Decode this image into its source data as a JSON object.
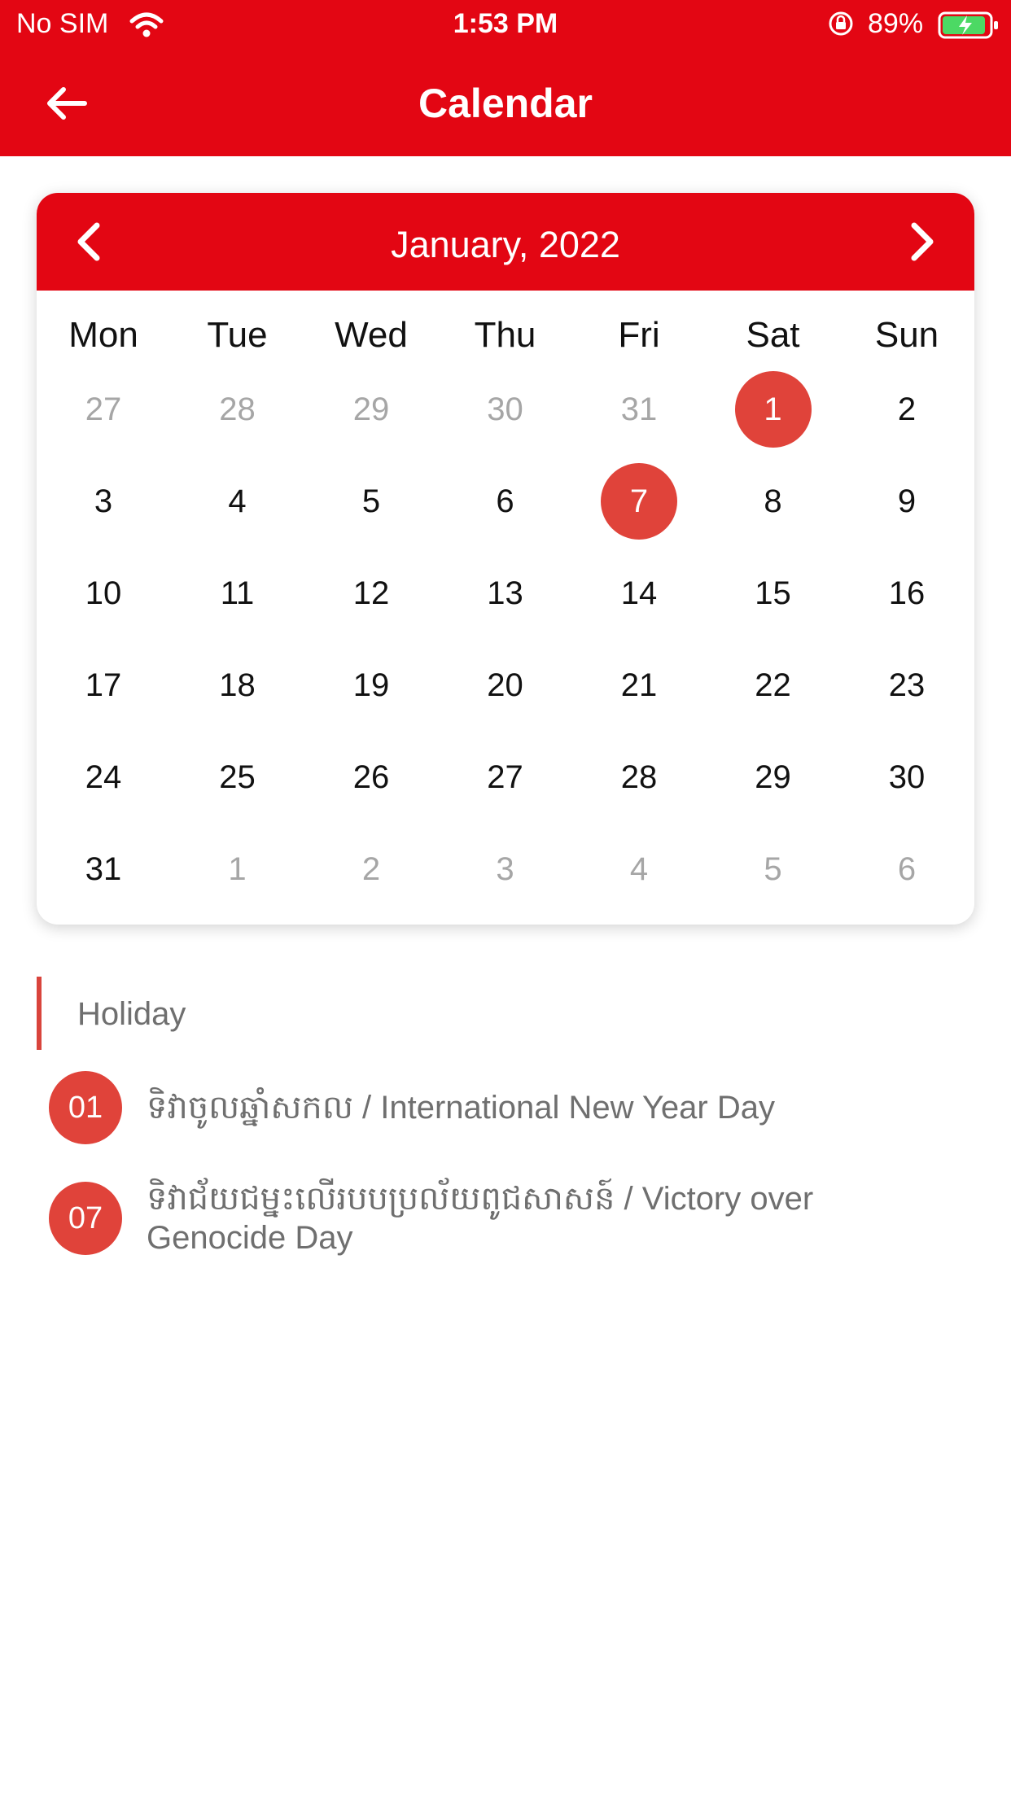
{
  "status": {
    "carrier": "No SIM",
    "time": "1:53 PM",
    "battery": "89%"
  },
  "app_bar": {
    "title": "Calendar"
  },
  "calendar": {
    "month_label": "January, 2022",
    "weekdays": [
      "Mon",
      "Tue",
      "Wed",
      "Thu",
      "Fri",
      "Sat",
      "Sun"
    ],
    "weeks": [
      [
        {
          "d": "27",
          "muted": true
        },
        {
          "d": "28",
          "muted": true
        },
        {
          "d": "29",
          "muted": true
        },
        {
          "d": "30",
          "muted": true
        },
        {
          "d": "31",
          "muted": true
        },
        {
          "d": "1",
          "holiday": true
        },
        {
          "d": "2"
        }
      ],
      [
        {
          "d": "3"
        },
        {
          "d": "4"
        },
        {
          "d": "5"
        },
        {
          "d": "6"
        },
        {
          "d": "7",
          "holiday": true
        },
        {
          "d": "8"
        },
        {
          "d": "9"
        }
      ],
      [
        {
          "d": "10"
        },
        {
          "d": "11"
        },
        {
          "d": "12"
        },
        {
          "d": "13"
        },
        {
          "d": "14"
        },
        {
          "d": "15"
        },
        {
          "d": "16"
        }
      ],
      [
        {
          "d": "17"
        },
        {
          "d": "18"
        },
        {
          "d": "19"
        },
        {
          "d": "20"
        },
        {
          "d": "21"
        },
        {
          "d": "22"
        },
        {
          "d": "23"
        }
      ],
      [
        {
          "d": "24"
        },
        {
          "d": "25"
        },
        {
          "d": "26"
        },
        {
          "d": "27"
        },
        {
          "d": "28"
        },
        {
          "d": "29"
        },
        {
          "d": "30"
        }
      ],
      [
        {
          "d": "31"
        },
        {
          "d": "1",
          "muted": true
        },
        {
          "d": "2",
          "muted": true
        },
        {
          "d": "3",
          "muted": true
        },
        {
          "d": "4",
          "muted": true
        },
        {
          "d": "5",
          "muted": true
        },
        {
          "d": "6",
          "muted": true
        }
      ]
    ]
  },
  "holidays": {
    "title": "Holiday",
    "items": [
      {
        "day": "01",
        "name": "ទិវាចូលឆ្នាំសកល / International New Year Day"
      },
      {
        "day": "07",
        "name": "ទិវាជ័យជម្នះលើរបបប្រល័យពូជសាសន៍ / Victory over Genocide Day"
      }
    ]
  },
  "colors": {
    "primary": "#e30613",
    "holiday": "#e0433a",
    "muted_text": "#a6a6a6"
  }
}
